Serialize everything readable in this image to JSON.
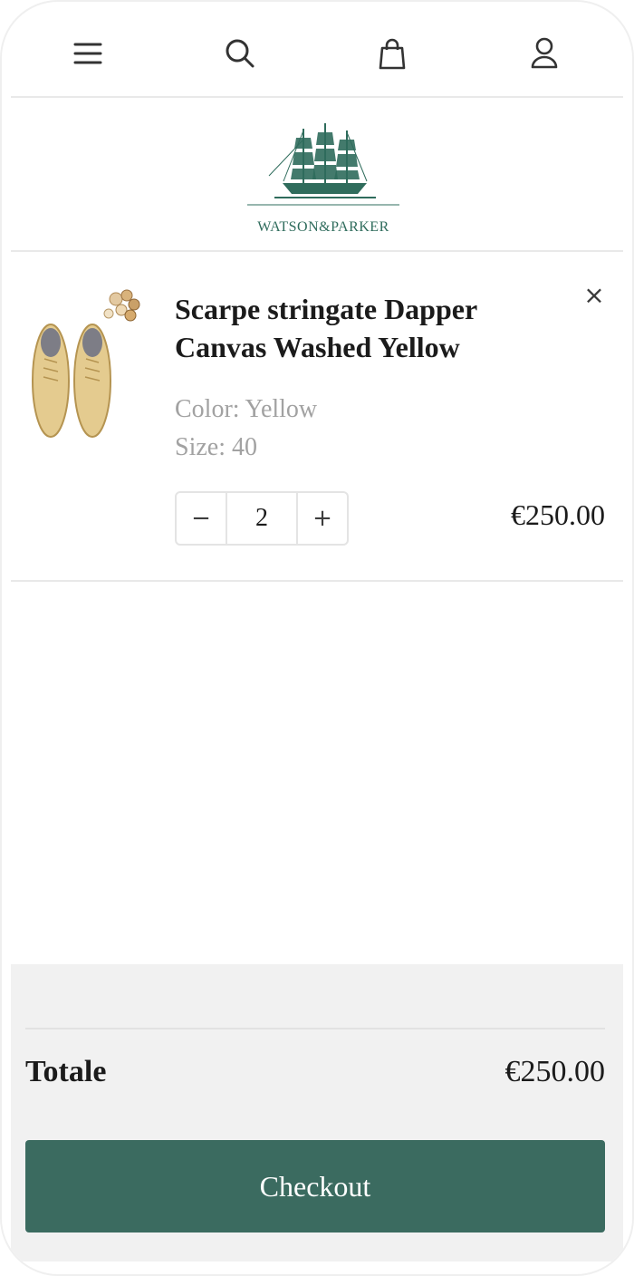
{
  "header": {
    "icons": [
      "menu-icon",
      "search-icon",
      "shopping-bag-icon",
      "user-icon"
    ]
  },
  "brand": {
    "logo_text": "WATSON&PARKER",
    "color": "#2f6c5c"
  },
  "cart": {
    "item": {
      "title": "Scarpe stringate Dapper Canvas Washed Yellow",
      "color_text": "Color: Yellow",
      "size_text": "Size: 40",
      "quantity": "2",
      "decrease_label": "−",
      "increase_label": "+",
      "price": "€250.00",
      "remove_label": "×"
    }
  },
  "footer": {
    "total_label": "Totale",
    "total_value": "€250.00",
    "checkout_label": "Checkout",
    "checkout_color": "#3b6b60"
  }
}
